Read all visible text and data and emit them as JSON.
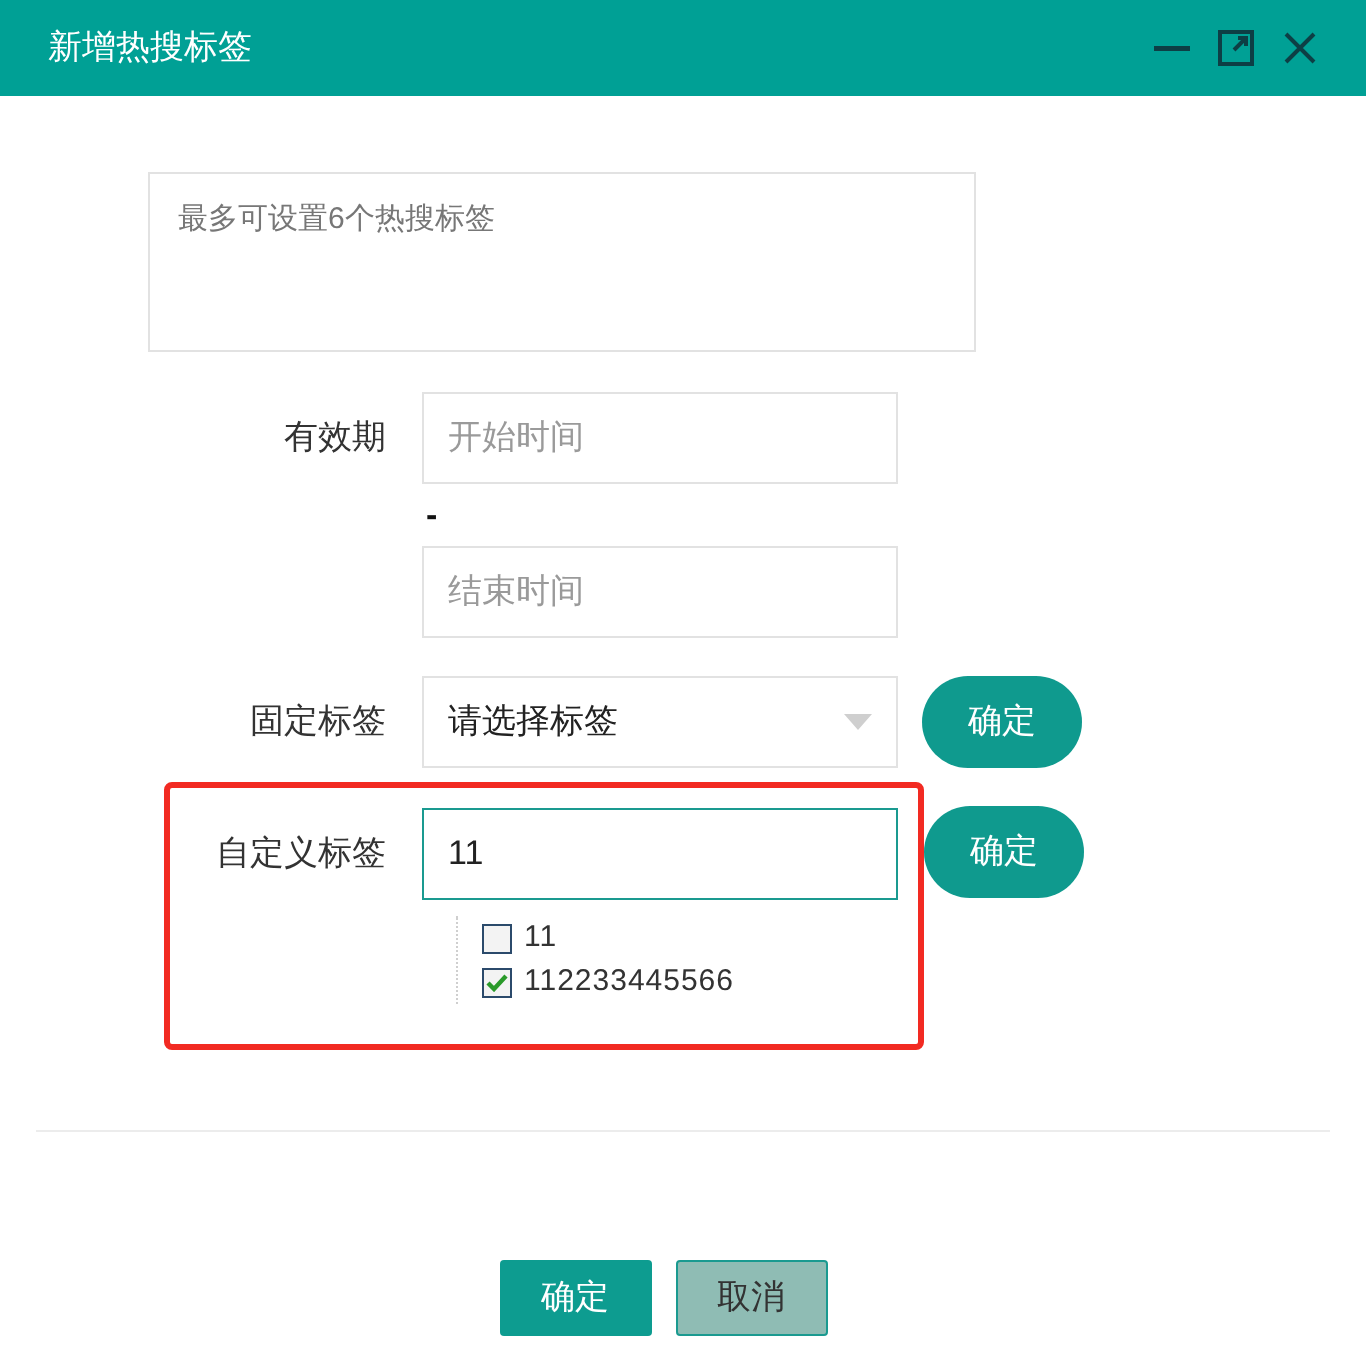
{
  "window": {
    "title": "新增热搜标签"
  },
  "notice": {
    "placeholder": "最多可设置6个热搜标签"
  },
  "validity": {
    "label": "有效期",
    "start": {
      "placeholder": "开始时间"
    },
    "separator": "-",
    "end": {
      "placeholder": "结束时间"
    }
  },
  "fixed_tag": {
    "label": "固定标签",
    "select": {
      "value": "请选择标签"
    },
    "button": "确定"
  },
  "custom_tag": {
    "label": "自定义标签",
    "input": {
      "value": "11"
    },
    "button": "确定",
    "options": [
      {
        "label": "11",
        "checked": false
      },
      {
        "label": "112233445566",
        "checked": true
      }
    ]
  },
  "footer": {
    "buttons": [
      {
        "label": "确定",
        "kind": "primary"
      },
      {
        "label": "取消",
        "kind": "secondary"
      }
    ]
  }
}
